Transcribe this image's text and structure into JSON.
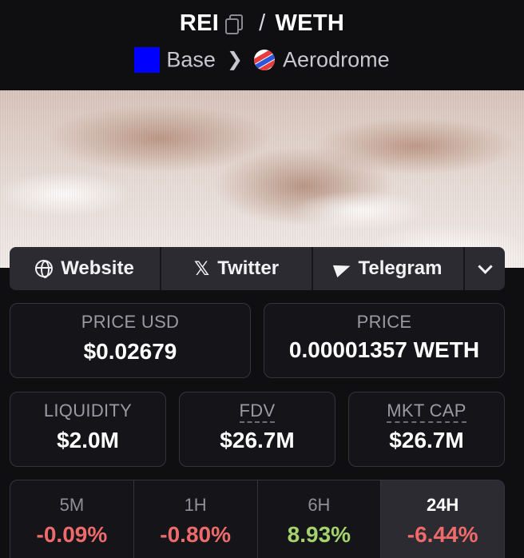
{
  "header": {
    "base_token": "REI",
    "separator": "/",
    "quote_token": "WETH",
    "chain": "Base",
    "dex": "Aerodrome",
    "chain_color": "#0000ff"
  },
  "socials": {
    "website": "Website",
    "twitter": "Twitter",
    "telegram": "Telegram"
  },
  "prices": {
    "price_usd_label": "PRICE USD",
    "price_usd_value": "$0.02679",
    "price_label": "PRICE",
    "price_value": "0.00001357 WETH"
  },
  "stats": {
    "liquidity_label": "LIQUIDITY",
    "liquidity_value": "$2.0M",
    "fdv_label": "FDV",
    "fdv_value": "$26.7M",
    "mktcap_label": "MKT CAP",
    "mktcap_value": "$26.7M"
  },
  "timeframes": [
    {
      "label": "5M",
      "value": "-0.09%"
    },
    {
      "label": "1H",
      "value": "-0.80%"
    },
    {
      "label": "6H",
      "value": "8.93%"
    },
    {
      "label": "24H",
      "value": "-6.44%"
    }
  ],
  "colors": {
    "negative": "#ef6b6b",
    "positive": "#a4d36e"
  }
}
